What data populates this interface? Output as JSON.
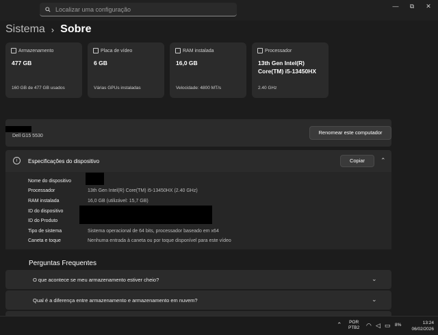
{
  "search": {
    "placeholder": "Localizar uma configuração"
  },
  "window_controls": {
    "minimize": "—",
    "maximize": "⧉",
    "close": "✕"
  },
  "breadcrumb": {
    "parent": "Sistema",
    "separator": "›",
    "current": "Sobre"
  },
  "cards": [
    {
      "label": "Armazenamento",
      "value": "477 GB",
      "footer": "160 GB de 477 GB usados",
      "icon": "storage-icon"
    },
    {
      "label": "Placa de vídeo",
      "value": "6 GB",
      "footer": "Várias GPUs instaladas",
      "icon": "gpu-icon"
    },
    {
      "label": "RAM instalada",
      "value": "16,0 GB",
      "footer": "Velocidade: 4800 MT/s",
      "icon": "ram-icon"
    },
    {
      "label": "Processador",
      "value": "13th Gen Intel(R) Core(TM) i5-13450HX",
      "footer": "2.40 GHz",
      "icon": "cpu-icon"
    }
  ],
  "device": {
    "model": "Dell G15 5530",
    "rename_label": "Renomear este computador"
  },
  "specs": {
    "title": "Especificações do dispositivo",
    "copy_label": "Copiar",
    "rows": [
      {
        "key": "Nome do dispositivo",
        "value": ""
      },
      {
        "key": "Processador",
        "value": "13th Gen Intel(R) Core(TM) i5-13450HX (2.40 GHz)"
      },
      {
        "key": "RAM instalada",
        "value": "16,0 GB (utilizável: 15,7 GB)"
      },
      {
        "key": "ID do dispositivo",
        "value": ""
      },
      {
        "key": "ID do Produto",
        "value": ""
      },
      {
        "key": "Tipo de sistema",
        "value": "Sistema operacional de 64 bits, processador baseado em x64"
      },
      {
        "key": "Caneta e toque",
        "value": "Nenhuma entrada à caneta ou por toque disponível para este vídeo"
      }
    ]
  },
  "faq": {
    "title": "Perguntas Frequentes",
    "items": [
      "O que acontece se meu armazenamento estiver cheio?",
      "Qual é a diferença entre armazenamento e armazenamento em nuvem?"
    ]
  },
  "taskbar": {
    "lang_line1": "POR",
    "lang_line2": "PTB2",
    "battery": "8%",
    "time": "13:24",
    "date": "06/02/2026"
  }
}
